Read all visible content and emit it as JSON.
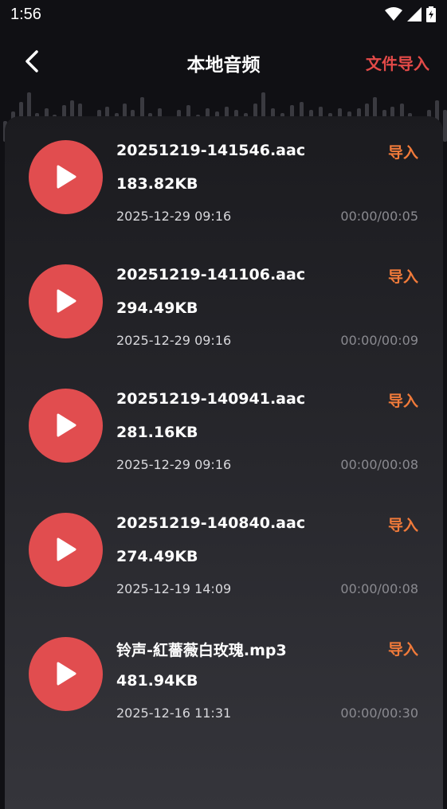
{
  "status_bar": {
    "time": "1:56"
  },
  "header": {
    "title": "本地音频",
    "import_file": "文件导入"
  },
  "colors": {
    "accent_red": "#e14d4f",
    "import_orange": "#f07a3a",
    "header_link": "#e34a48"
  },
  "files": [
    {
      "name": "20251219-141546.aac",
      "size": "183.82KB",
      "date": "2025-12-29 09:16",
      "duration": "00:00/00:05",
      "import": "导入"
    },
    {
      "name": "20251219-141106.aac",
      "size": "294.49KB",
      "date": "2025-12-29 09:16",
      "duration": "00:00/00:09",
      "import": "导入"
    },
    {
      "name": "20251219-140941.aac",
      "size": "281.16KB",
      "date": "2025-12-29 09:16",
      "duration": "00:00/00:08",
      "import": "导入"
    },
    {
      "name": "20251219-140840.aac",
      "size": "274.49KB",
      "date": "2025-12-19 14:09",
      "duration": "00:00/00:08",
      "import": "导入"
    },
    {
      "name": "铃声-紅薔薇白玫瑰.mp3",
      "size": "481.94KB",
      "date": "2025-12-16 11:31",
      "duration": "00:00/00:30",
      "import": "导入"
    }
  ]
}
